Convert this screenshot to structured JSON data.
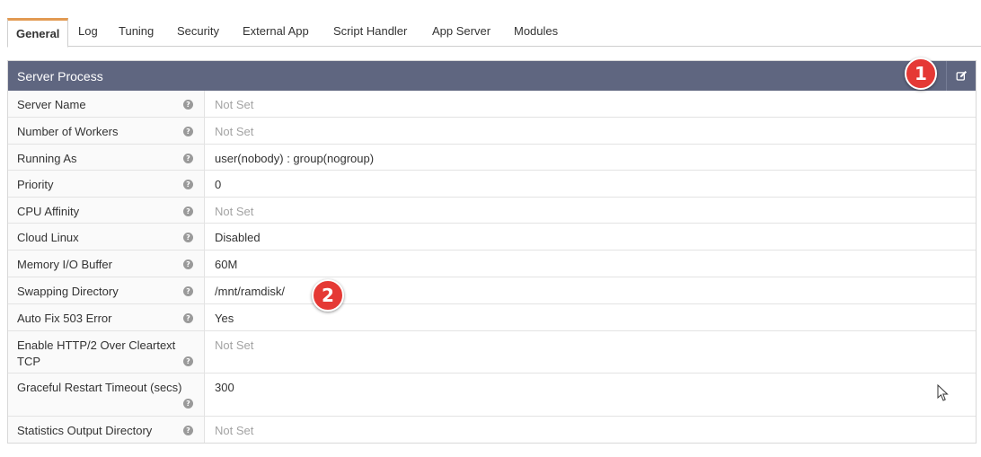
{
  "tabs": [
    {
      "label": "General",
      "active": true
    },
    {
      "label": "Log"
    },
    {
      "label": "Tuning"
    },
    {
      "label": "Security"
    },
    {
      "label": "External App"
    },
    {
      "label": "Script Handler"
    },
    {
      "label": "App Server"
    },
    {
      "label": "Modules"
    }
  ],
  "panel": {
    "title": "Server Process",
    "edit_icon": "edit-icon",
    "help_icon": "question-circle-icon"
  },
  "rows": [
    {
      "label": "Server Name",
      "value": "Not Set"
    },
    {
      "label": "Number of Workers",
      "value": "Not Set"
    },
    {
      "label": "Running As",
      "value": "user(nobody) : group(nogroup)"
    },
    {
      "label": "Priority",
      "value": "0"
    },
    {
      "label": "CPU Affinity",
      "value": "Not Set"
    },
    {
      "label": "Cloud Linux",
      "value": "Disabled"
    },
    {
      "label": "Memory I/O Buffer",
      "value": "60M"
    },
    {
      "label": "Swapping Directory",
      "value": "/mnt/ramdisk/"
    },
    {
      "label": "Auto Fix 503 Error",
      "value": "Yes"
    },
    {
      "label": "Enable HTTP/2 Over Cleartext TCP",
      "value": "Not Set"
    },
    {
      "label": "Graceful Restart Timeout (secs)",
      "value": "300"
    },
    {
      "label": "Statistics Output Directory",
      "value": "Not Set"
    }
  ],
  "annotations": [
    {
      "number": "1"
    },
    {
      "number": "2"
    }
  ],
  "colors": {
    "header_bg": "#5f6680",
    "active_tab_accent": "#e29a52",
    "badge": "#e53935",
    "not_set_text": "#a3a3a3"
  }
}
